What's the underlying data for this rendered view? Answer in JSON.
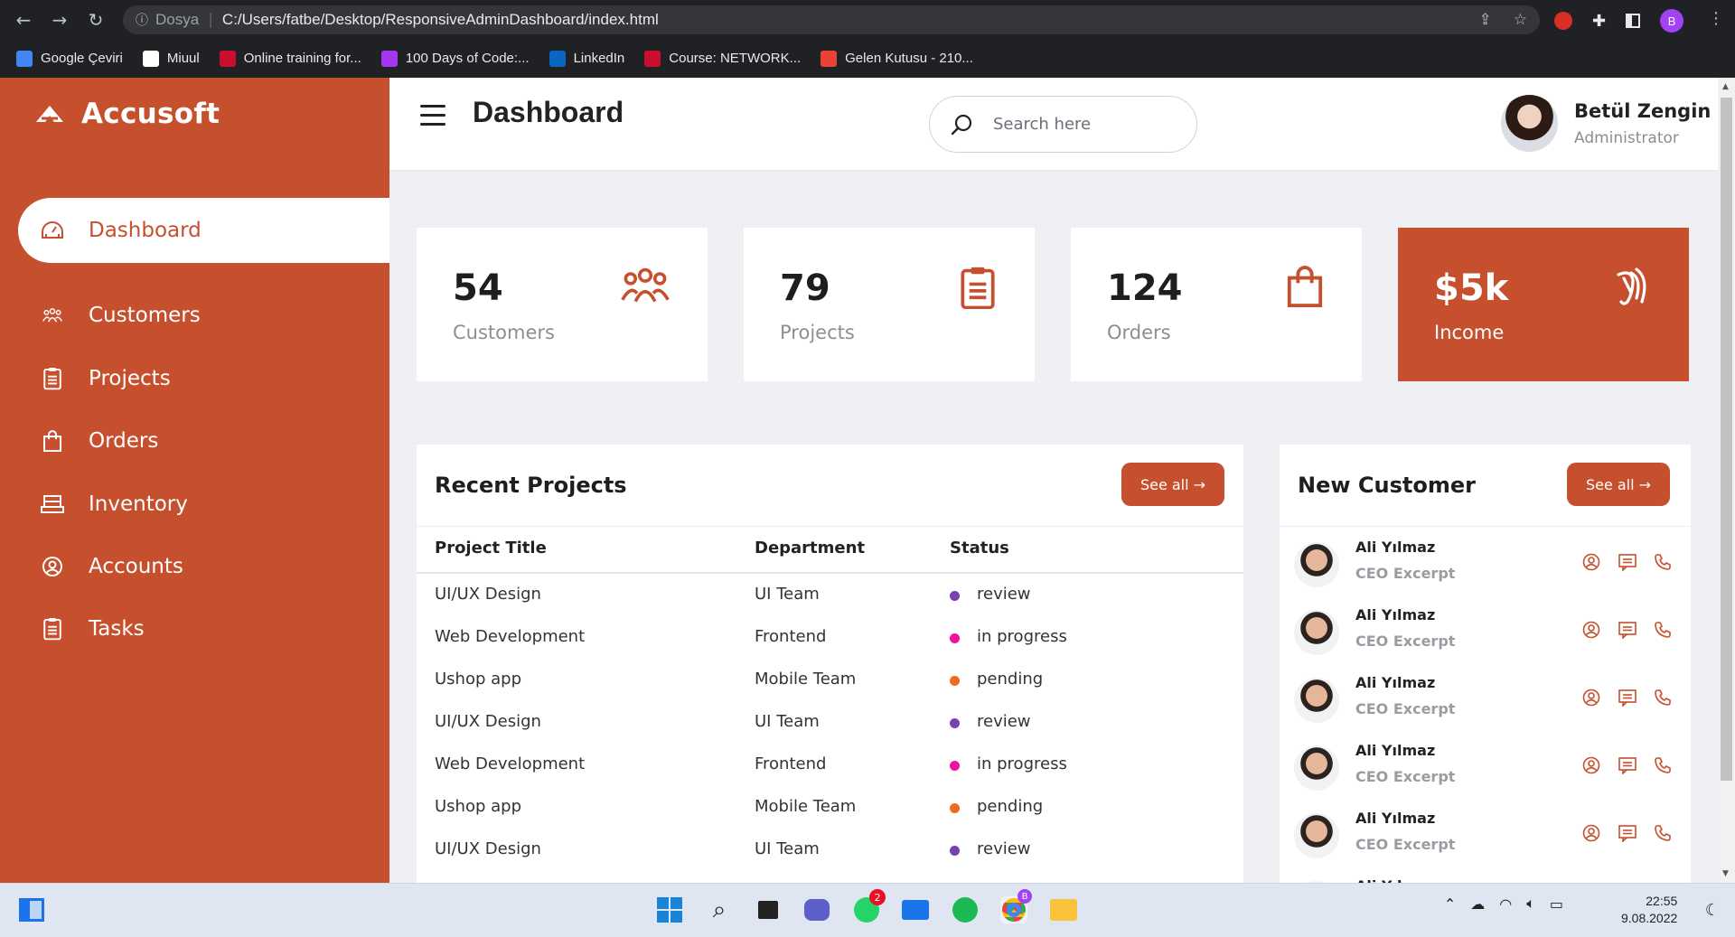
{
  "browser": {
    "scheme_label": "Dosya",
    "url": "C:/Users/fatbe/Desktop/ResponsiveAdminDashboard/index.html",
    "profile_initial": "B",
    "bookmarks": [
      {
        "label": "Google Çeviri",
        "icon": "google-translate-icon",
        "color": "#4285f4"
      },
      {
        "label": "Miuul",
        "icon": "miuul-icon",
        "color": "#ffffff"
      },
      {
        "label": "Online training for...",
        "icon": "udemy-icon",
        "color": "#c8102e"
      },
      {
        "label": "100 Days of Code:...",
        "icon": "udemy-purple-icon",
        "color": "#a435f0"
      },
      {
        "label": "LinkedIn",
        "icon": "linkedin-icon",
        "color": "#0a66c2"
      },
      {
        "label": "Course: NETWORK...",
        "icon": "course-icon",
        "color": "#c8102e"
      },
      {
        "label": "Gelen Kutusu - 210...",
        "icon": "gmail-icon",
        "color": "#ea4335"
      }
    ]
  },
  "brand": {
    "name": "Accusoft"
  },
  "sidebar": {
    "items": [
      {
        "label": "Dashboard",
        "icon": "dashboard-icon"
      },
      {
        "label": "Customers",
        "icon": "customers-icon"
      },
      {
        "label": "Projects",
        "icon": "clipboard-icon"
      },
      {
        "label": "Orders",
        "icon": "bag-icon"
      },
      {
        "label": "Inventory",
        "icon": "inventory-icon"
      },
      {
        "label": "Accounts",
        "icon": "account-icon"
      },
      {
        "label": "Tasks",
        "icon": "tasks-icon"
      }
    ]
  },
  "header": {
    "title": "Dashboard",
    "search_placeholder": "Search here",
    "user_name": "Betül Zengin",
    "user_role": "Administrator"
  },
  "cards": [
    {
      "value": "54",
      "label": "Customers",
      "icon": "customers-icon"
    },
    {
      "value": "79",
      "label": "Projects",
      "icon": "clipboard-icon"
    },
    {
      "value": "124",
      "label": "Orders",
      "icon": "bag-icon"
    },
    {
      "value": "$5k",
      "label": "Income",
      "icon": "income-icon"
    }
  ],
  "recent_projects": {
    "title": "Recent Projects",
    "see_all": "See all →",
    "columns": [
      "Project Title",
      "Department",
      "Status"
    ],
    "rows": [
      {
        "title": "UI/UX Design",
        "dept": "UI Team",
        "status": "review",
        "color": "#7a3fb0"
      },
      {
        "title": "Web Development",
        "dept": "Frontend",
        "status": "in progress",
        "color": "#f0129a"
      },
      {
        "title": "Ushop app",
        "dept": "Mobile Team",
        "status": "pending",
        "color": "#f26a1b"
      },
      {
        "title": "UI/UX Design",
        "dept": "UI Team",
        "status": "review",
        "color": "#7a3fb0"
      },
      {
        "title": "Web Development",
        "dept": "Frontend",
        "status": "in progress",
        "color": "#f0129a"
      },
      {
        "title": "Ushop app",
        "dept": "Mobile Team",
        "status": "pending",
        "color": "#f26a1b"
      },
      {
        "title": "UI/UX Design",
        "dept": "UI Team",
        "status": "review",
        "color": "#7a3fb0"
      }
    ]
  },
  "new_customer": {
    "title": "New Customer",
    "see_all": "See all →",
    "items": [
      {
        "name": "Ali Yılmaz",
        "role": "CEO Excerpt"
      },
      {
        "name": "Ali Yılmaz",
        "role": "CEO Excerpt"
      },
      {
        "name": "Ali Yılmaz",
        "role": "CEO Excerpt"
      },
      {
        "name": "Ali Yılmaz",
        "role": "CEO Excerpt"
      },
      {
        "name": "Ali Yılmaz",
        "role": "CEO Excerpt"
      },
      {
        "name": "Ali Yılmaz",
        "role": ""
      }
    ]
  },
  "taskbar": {
    "time": "22:55",
    "date": "9.08.2022",
    "whatsapp_badge": "2",
    "chrome_badge": "B"
  },
  "colors": {
    "accent": "#c64f2e",
    "background": "#eef0f4"
  }
}
